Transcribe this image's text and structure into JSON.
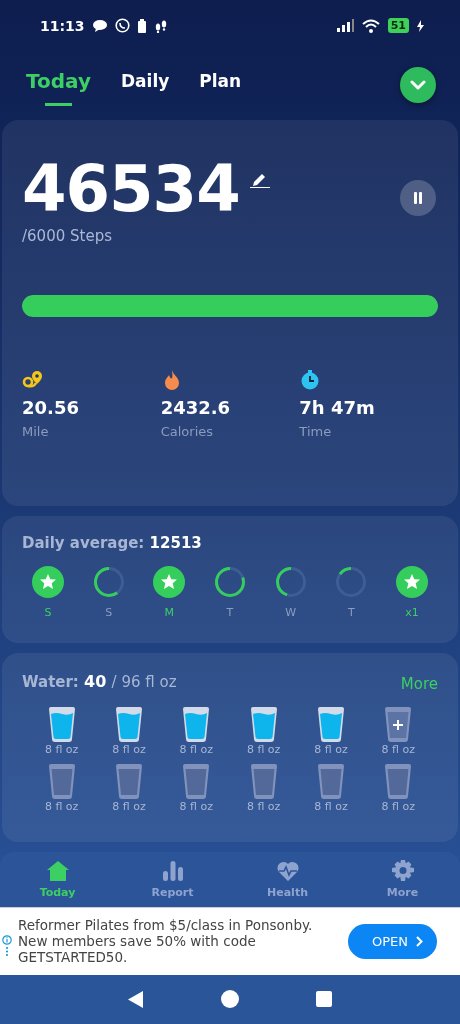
{
  "status_bar": {
    "time": "11:13",
    "battery": "51"
  },
  "tabs": [
    {
      "label": "Today",
      "selected": true
    },
    {
      "label": "Daily",
      "selected": false
    },
    {
      "label": "Plan",
      "selected": false
    }
  ],
  "steps": {
    "count": "46534",
    "goal": "/6000 Steps",
    "level": 1.0,
    "paused": false
  },
  "stats": [
    {
      "kind": "distance",
      "value": "20.56",
      "label": "Mile"
    },
    {
      "kind": "calories",
      "value": "2432.6",
      "label": "Calories"
    },
    {
      "kind": "time",
      "value": "7h 47m",
      "label": "Time"
    }
  ],
  "daily_average": {
    "label": "Daily average:",
    "value": "12513"
  },
  "days": [
    {
      "kind": "star",
      "label": "S"
    },
    {
      "kind": "ring",
      "label": "S",
      "level": 0.6
    },
    {
      "kind": "star",
      "label": "M"
    },
    {
      "kind": "ring",
      "label": "T",
      "level": 0.8
    },
    {
      "kind": "ring",
      "label": "W",
      "level": 0.45
    },
    {
      "kind": "ring",
      "label": "T",
      "level": 0.15
    },
    {
      "kind": "star",
      "label": "x1"
    }
  ],
  "water": {
    "label": "Water:",
    "amount": "40",
    "goal": "/ 96 fl oz",
    "more": "More"
  },
  "glasses": [
    {
      "kind": "full",
      "label": "8 fl oz"
    },
    {
      "kind": "full",
      "label": "8 fl oz"
    },
    {
      "kind": "full",
      "label": "8 fl oz"
    },
    {
      "kind": "full",
      "label": "8 fl oz"
    },
    {
      "kind": "full",
      "label": "8 fl oz"
    },
    {
      "kind": "add",
      "label": "8 fl oz"
    },
    {
      "kind": "empty",
      "label": "8 fl oz"
    },
    {
      "kind": "empty",
      "label": "8 fl oz"
    },
    {
      "kind": "empty",
      "label": "8 fl oz"
    },
    {
      "kind": "empty",
      "label": "8 fl oz"
    },
    {
      "kind": "empty",
      "label": "8 fl oz"
    },
    {
      "kind": "empty",
      "label": "8 fl oz"
    }
  ],
  "bottom_nav": [
    {
      "kind": "home",
      "label": "Today",
      "selected": true
    },
    {
      "kind": "report",
      "label": "Report",
      "selected": false
    },
    {
      "kind": "health",
      "label": "Health",
      "selected": false
    },
    {
      "kind": "more",
      "label": "More",
      "selected": false
    }
  ],
  "ad": {
    "text": "Reformer Pilates from $5/class in Ponsonby. New members save 50% with code GETSTARTED50.",
    "button": "OPEN"
  }
}
